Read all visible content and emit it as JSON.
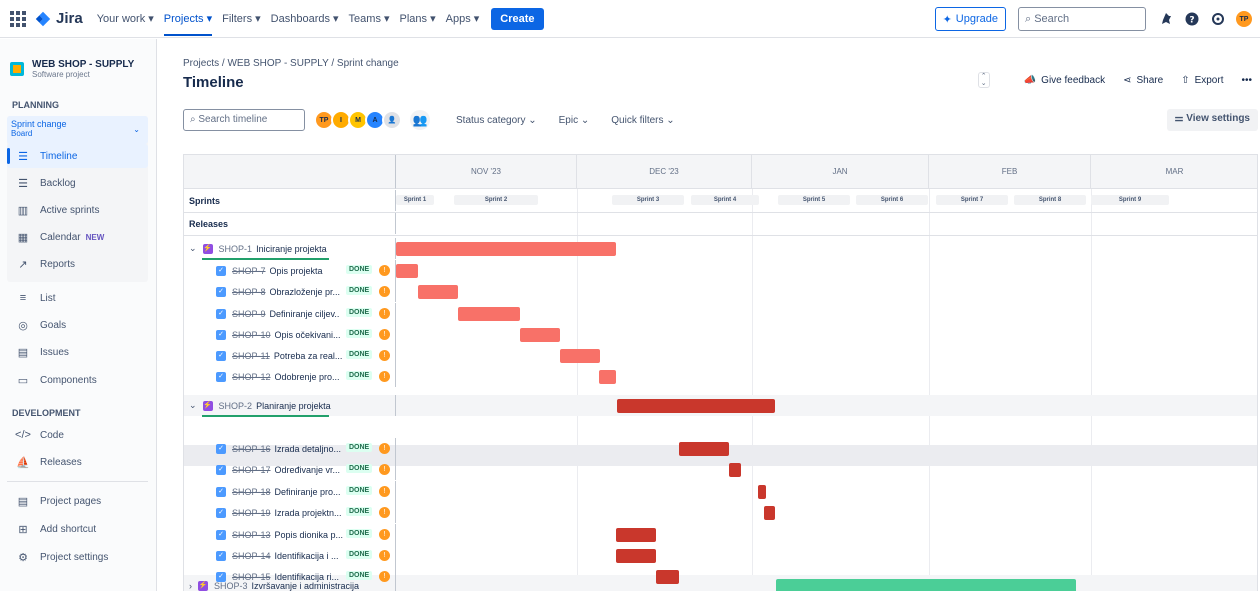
{
  "topbar": {
    "logo": "Jira",
    "nav": [
      "Your work ▾",
      "Projects ▾",
      "Filters ▾",
      "Dashboards ▾",
      "Teams ▾",
      "Plans ▾",
      "Apps ▾"
    ],
    "create": "Create",
    "upgrade": "Upgrade",
    "search_placeholder": "Search",
    "avatar": "TP"
  },
  "sidebar": {
    "project_name": "WEB SHOP - SUPPLY",
    "project_type": "Software project",
    "planning_label": "PLANNING",
    "board_name": "Sprint change",
    "board_sub": "Board",
    "planning_items": [
      "Timeline",
      "Backlog",
      "Active sprints",
      "Calendar",
      "Reports"
    ],
    "new_badge": "NEW",
    "other_items": [
      "List",
      "Goals",
      "Issues",
      "Components"
    ],
    "development_label": "DEVELOPMENT",
    "dev_items": [
      "Code",
      "Releases"
    ],
    "bottom_items": [
      "Project pages",
      "Add shortcut",
      "Project settings"
    ]
  },
  "header": {
    "breadcrumb": "Projects  /  WEB SHOP - SUPPLY  /  Sprint change",
    "title": "Timeline",
    "give_feedback": "Give feedback",
    "share": "Share",
    "export": "Export",
    "more": "•••"
  },
  "filters": {
    "search_placeholder": "Search timeline",
    "avatars": [
      {
        "initials": "TP",
        "color": "#FF991F"
      },
      {
        "initials": "I",
        "color": "#FFAB00"
      },
      {
        "initials": "M",
        "color": "#FFC400"
      },
      {
        "initials": "A",
        "color": "#2684FF"
      }
    ],
    "status_category": "Status category ⌄",
    "epic": "Epic ⌄",
    "quick_filters": "Quick filters ⌄",
    "view_settings": "View settings"
  },
  "timeline": {
    "months": [
      "NOV '23",
      "DEC '23",
      "JAN",
      "FEB",
      "MAR"
    ],
    "sprints_label": "Sprints",
    "releases_label": "Releases",
    "sprints": [
      "Sprint 1",
      "Sprint 2",
      "Sprint 3",
      "Sprint 4",
      "Sprint 5",
      "Sprint 6",
      "Sprint 7",
      "Sprint 8",
      "Sprint 9"
    ],
    "epics": [
      {
        "key": "SHOP-1",
        "name": "Iniciranje projekta"
      },
      {
        "key": "SHOP-2",
        "name": "Planiranje projekta"
      },
      {
        "key": "SHOP-3",
        "name": "Izvršavanje i administracija"
      }
    ],
    "issues": [
      {
        "key": "SHOP-7",
        "summary": "Opis projekta"
      },
      {
        "key": "SHOP-8",
        "summary": "Obrazloženje pr..."
      },
      {
        "key": "SHOP-9",
        "summary": "Definiranje ciljev..."
      },
      {
        "key": "SHOP-10",
        "summary": "Opis očekivani..."
      },
      {
        "key": "SHOP-11",
        "summary": "Potreba za real..."
      },
      {
        "key": "SHOP-12",
        "summary": "Odobrenje pro..."
      },
      {
        "key": "SHOP-16",
        "summary": "Izrada detaljno..."
      },
      {
        "key": "SHOP-17",
        "summary": "Određivanje vr..."
      },
      {
        "key": "SHOP-18",
        "summary": "Definiranje pro..."
      },
      {
        "key": "SHOP-19",
        "summary": "Izrada projektn..."
      },
      {
        "key": "SHOP-13",
        "summary": "Popis dionika p..."
      },
      {
        "key": "SHOP-14",
        "summary": "Identifikacija i ..."
      },
      {
        "key": "SHOP-15",
        "summary": "Identifikacija ri..."
      }
    ],
    "status": "DONE",
    "colors": {
      "epic1": "#F87168",
      "epic2": "#C9372C",
      "epic3": "#4BCE97"
    }
  }
}
